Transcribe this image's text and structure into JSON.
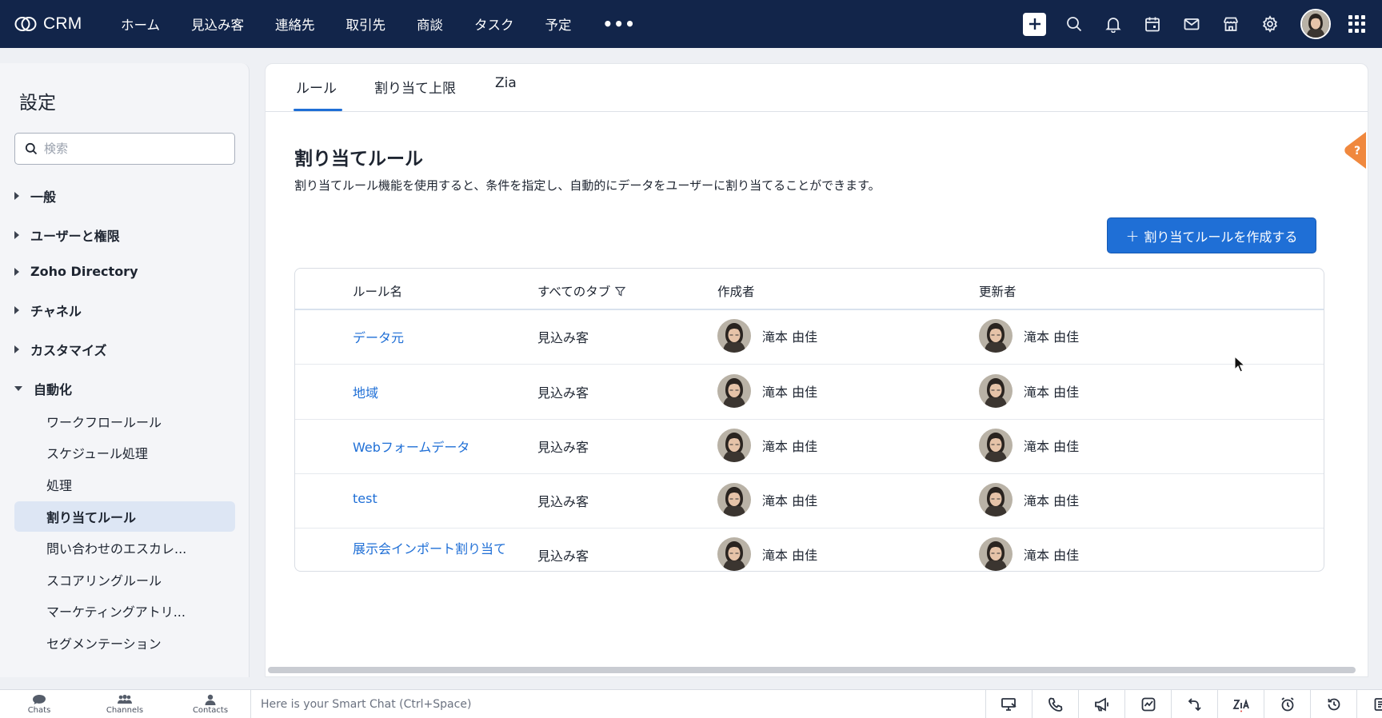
{
  "app": {
    "name": "CRM"
  },
  "nav": {
    "items": [
      "ホーム",
      "見込み客",
      "連絡先",
      "取引先",
      "商談",
      "タスク",
      "予定"
    ],
    "more_label": "•••",
    "icons": [
      "plus-icon",
      "search-icon",
      "bell-icon",
      "calendar-icon",
      "mail-icon",
      "store-icon",
      "gear-icon",
      "avatar",
      "apps-grid-icon"
    ]
  },
  "sidebar": {
    "title": "設定",
    "search_placeholder": "検索",
    "groups": [
      {
        "label": "一般",
        "expanded": false
      },
      {
        "label": "ユーザーと権限",
        "expanded": false
      },
      {
        "label": "Zoho Directory",
        "expanded": false
      },
      {
        "label": "チャネル",
        "expanded": false
      },
      {
        "label": "カスタマイズ",
        "expanded": false
      },
      {
        "label": "自動化",
        "expanded": true
      }
    ],
    "sub_items": [
      "ワークフロールール",
      "スケジュール処理",
      "処理",
      "割り当てルール",
      "問い合わせのエスカレ...",
      "スコアリングルール",
      "マーケティングアトリ...",
      "セグメンテーション"
    ],
    "active_sub": "割り当てルール"
  },
  "tabs": {
    "items": [
      "ルール",
      "割り当て上限",
      "Zia"
    ],
    "active": "ルール"
  },
  "page": {
    "title": "割り当てルール",
    "description": "割り当てルール機能を使用すると、条件を指定し、自動的にデータをユーザーに割り当てることができます。",
    "create_button": "割り当てルールを作成する"
  },
  "table": {
    "headers": [
      "ルール名",
      "すべてのタブ",
      "作成者",
      "更新者"
    ],
    "rows": [
      {
        "name": "データ元",
        "tab": "見込み客",
        "creator": "滝本 由佳",
        "updater": "滝本 由佳"
      },
      {
        "name": "地域",
        "tab": "見込み客",
        "creator": "滝本 由佳",
        "updater": "滝本 由佳"
      },
      {
        "name": "Webフォームデータ",
        "tab": "見込み客",
        "creator": "滝本 由佳",
        "updater": "滝本 由佳"
      },
      {
        "name": "test",
        "tab": "見込み客",
        "creator": "滝本 由佳",
        "updater": "滝本 由佳"
      },
      {
        "name": "展示会インポート割り当て",
        "tab": "見込み客",
        "creator": "滝本 由佳",
        "updater": "滝本 由佳"
      }
    ]
  },
  "bottombar": {
    "buttons": [
      "Chats",
      "Channels",
      "Contacts"
    ],
    "chat_placeholder": "Here is your Smart Chat (Ctrl+Space)",
    "tools": [
      "screen-share-icon",
      "phone-icon",
      "megaphone-icon",
      "chart-icon",
      "rotate-icon",
      "zia-icon",
      "alarm-icon",
      "history-icon",
      "notes-icon"
    ]
  },
  "colors": {
    "topbar": "#12254a",
    "accent": "#1f6fd6",
    "link": "#1f6fd6",
    "help": "#f0883e"
  }
}
